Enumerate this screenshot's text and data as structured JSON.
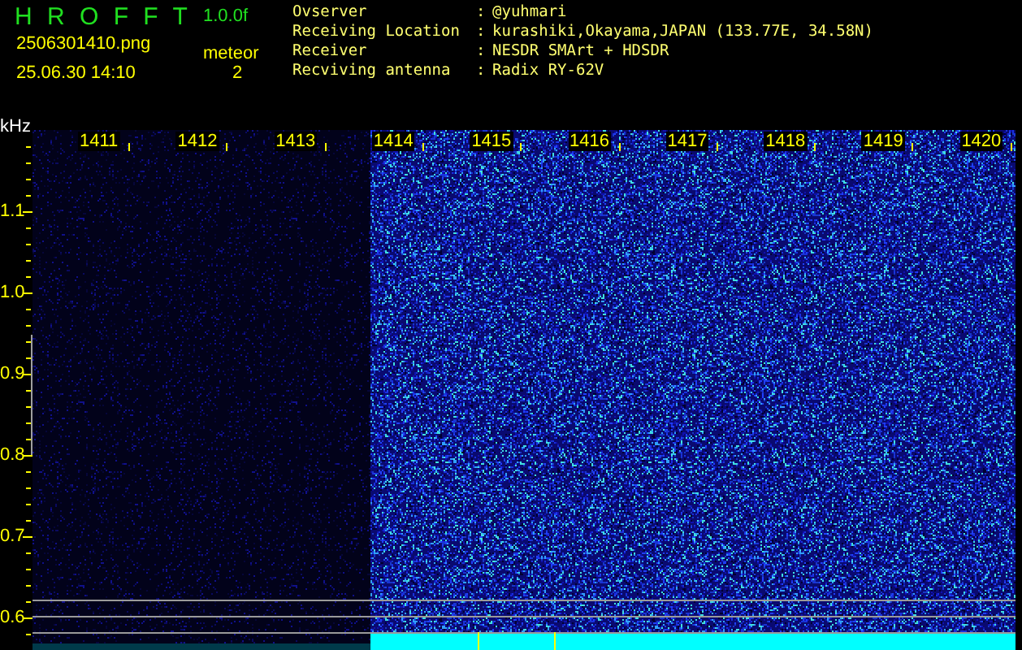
{
  "header": {
    "title": "H R O F F T",
    "version": "1.0.0f",
    "filename": "2506301410.png",
    "timestamp": "25.06.30 14:10",
    "event_label": "meteor",
    "event_count": "2"
  },
  "info": [
    {
      "label": "Ovserver",
      "separator": ":",
      "value": "@yuhmari"
    },
    {
      "label": "Receiving Location",
      "separator": ":",
      "value": "kurashiki,Okayama,JAPAN (133.77E, 34.58N)"
    },
    {
      "label": "Receiver",
      "separator": ":",
      "value": "NESDR SMArt + HDSDR"
    },
    {
      "label": "Recviving antenna",
      "separator": ":",
      "value": "Radix RY-62V"
    }
  ],
  "plot": {
    "frequency_unit": "kHz",
    "frequency_labels": [
      "1411",
      "1412",
      "1413",
      "1414",
      "1415",
      "1416",
      "1417",
      "1418",
      "1419",
      "1420"
    ],
    "y_labels": [
      "1.1",
      "1.0",
      "0.9",
      "0.8",
      "0.7",
      "0.6"
    ]
  }
}
